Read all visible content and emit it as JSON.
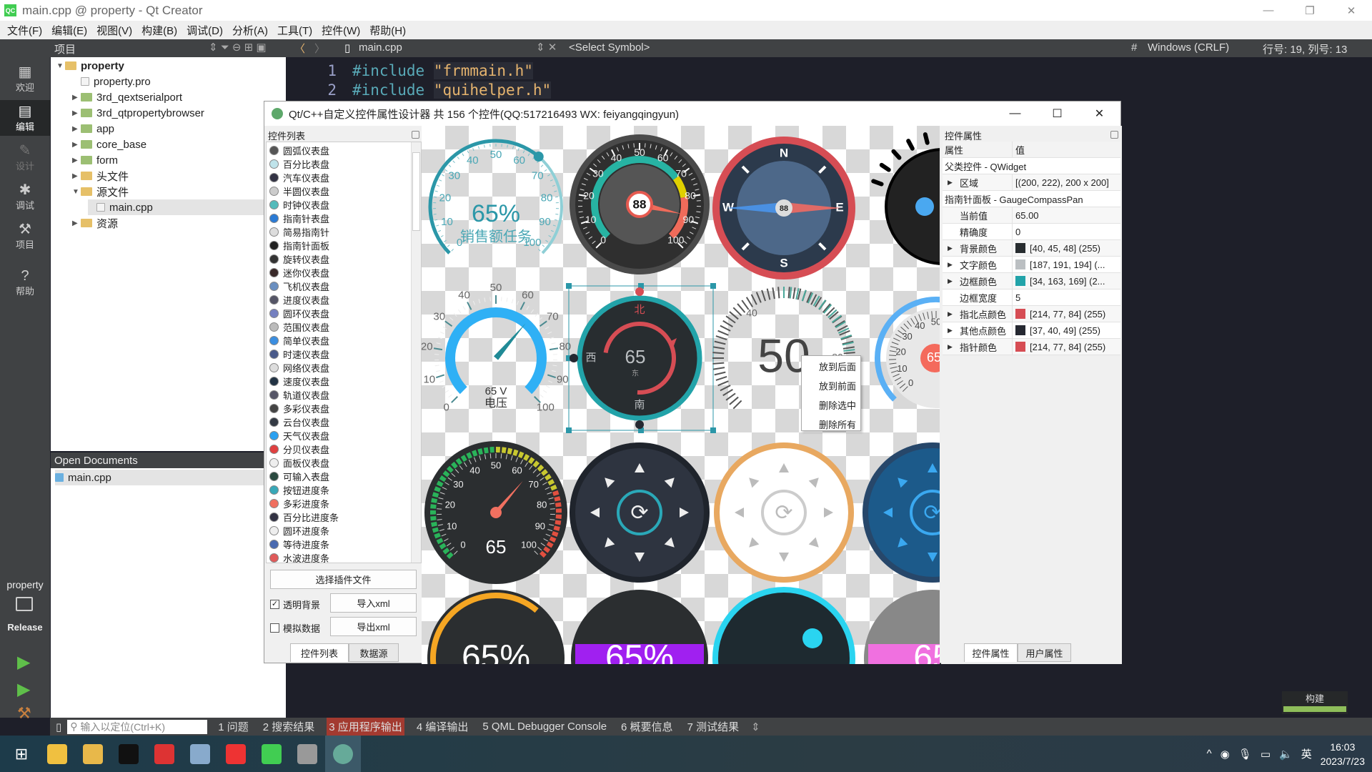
{
  "window": {
    "title": "main.cpp @ property - Qt Creator",
    "minimize": "—",
    "restore": "❐",
    "close": "✕",
    "logo": "QC"
  },
  "menu": [
    "文件(F)",
    "编辑(E)",
    "视图(V)",
    "构建(B)",
    "调试(D)",
    "分析(A)",
    "工具(T)",
    "控件(W)",
    "帮助(H)"
  ],
  "toolbar": {
    "projects_label": "项目",
    "file": "main.cpp",
    "symbol": "<Select Symbol>",
    "hash": "#",
    "line_ending": "Windows (CRLF)",
    "position": "行号: 19, 列号: 13"
  },
  "modes": [
    {
      "label": "欢迎",
      "icon": "grid-icon"
    },
    {
      "label": "编辑",
      "icon": "edit-icon"
    },
    {
      "label": "设计",
      "icon": "pencil-icon"
    },
    {
      "label": "调试",
      "icon": "bug-icon"
    },
    {
      "label": "项目",
      "icon": "wrench-icon"
    },
    {
      "label": "帮助",
      "icon": "help-icon"
    }
  ],
  "kit": {
    "project": "property",
    "config": "Release"
  },
  "tree": [
    {
      "label": "property",
      "level": 0,
      "open": true,
      "bold": true
    },
    {
      "label": "property.pro",
      "level": 1
    },
    {
      "label": "3rd_qextserialport",
      "level": 1,
      "closed": true
    },
    {
      "label": "3rd_qtpropertybrowser",
      "level": 1,
      "closed": true
    },
    {
      "label": "app",
      "level": 1,
      "closed": true
    },
    {
      "label": "core_base",
      "level": 1,
      "closed": true
    },
    {
      "label": "form",
      "level": 1,
      "closed": true
    },
    {
      "label": "头文件",
      "level": 1,
      "closed": true
    },
    {
      "label": "源文件",
      "level": 1,
      "open": true
    },
    {
      "label": "main.cpp",
      "level": 2,
      "selected": true
    },
    {
      "label": "资源",
      "level": 1,
      "closed": true
    }
  ],
  "open_documents": {
    "title": "Open Documents",
    "items": [
      "main.cpp"
    ]
  },
  "code": [
    {
      "n": "1",
      "kw": "#include",
      "s": "\"frmmain.h\""
    },
    {
      "n": "2",
      "kw": "#include",
      "s": "\"quihelper.h\""
    }
  ],
  "output_tabs": [
    "1 问题",
    "2 搜索结果",
    "3 应用程序输出",
    "4 编译输出",
    "5 QML Debugger Console",
    "6 概要信息",
    "7 测试结果"
  ],
  "locate_placeholder": "输入以定位(Ctrl+K)",
  "build": {
    "label": "构建",
    "progress": 100
  },
  "clock": {
    "time": "16:03",
    "date": "2023/7/23"
  },
  "tray": {
    "ime": "英"
  },
  "dialog": {
    "title": "Qt/C++自定义控件属性设计器 共 156 个控件(QQ:517216493 WX: feiyangqingyun)",
    "list_title": "控件列表",
    "widgets": [
      {
        "n": "圆弧仪表盘",
        "c": "#555"
      },
      {
        "n": "百分比表盘",
        "c": "#bfe3ea"
      },
      {
        "n": "汽车仪表盘",
        "c": "#334"
      },
      {
        "n": "半圆仪表盘",
        "c": "#ccc"
      },
      {
        "n": "时钟仪表盘",
        "c": "#5bb"
      },
      {
        "n": "指南针表盘",
        "c": "#2a7ad4"
      },
      {
        "n": "简易指南针",
        "c": "#ddd"
      },
      {
        "n": "指南针面板",
        "c": "#222"
      },
      {
        "n": "旋转仪表盘",
        "c": "#333"
      },
      {
        "n": "迷你仪表盘",
        "c": "#3a2a2a"
      },
      {
        "n": "飞机仪表盘",
        "c": "#6a8fc0"
      },
      {
        "n": "进度仪表盘",
        "c": "#556"
      },
      {
        "n": "圆环仪表盘",
        "c": "#7580c0"
      },
      {
        "n": "范围仪表盘",
        "c": "#bbb"
      },
      {
        "n": "简单仪表盘",
        "c": "#3b8ee0"
      },
      {
        "n": "时速仪表盘",
        "c": "#4a5a8a"
      },
      {
        "n": "网络仪表盘",
        "c": "#ddd"
      },
      {
        "n": "速度仪表盘",
        "c": "#234"
      },
      {
        "n": "轨道仪表盘",
        "c": "#556"
      },
      {
        "n": "多彩仪表盘",
        "c": "#444"
      },
      {
        "n": "云台仪表盘",
        "c": "#333a44"
      },
      {
        "n": "天气仪表盘",
        "c": "#2aa0f0"
      },
      {
        "n": "分贝仪表盘",
        "c": "#e04040"
      },
      {
        "n": "面板仪表盘",
        "c": "#eee"
      },
      {
        "n": "可输入表盘",
        "c": "#2a4a40"
      },
      {
        "n": "按钮进度条",
        "c": "#38a8b8"
      },
      {
        "n": "多彩进度条",
        "c": "#f07060"
      },
      {
        "n": "百分比进度条",
        "c": "#334"
      },
      {
        "n": "圆环进度条",
        "c": "#eee"
      },
      {
        "n": "等待进度条",
        "c": "#4a6ab0"
      },
      {
        "n": "水波进度条",
        "c": "#e05a5a"
      }
    ],
    "select_plugin": "选择插件文件",
    "transparent_bg": {
      "label": "透明背景",
      "checked": true
    },
    "simulate": {
      "label": "模拟数据",
      "checked": false
    },
    "import_xml": "导入xml",
    "export_xml": "导出xml",
    "left_tabs": [
      "控件列表",
      "数据源"
    ],
    "context_menu": [
      "放到后面",
      "放到前面",
      "删除选中",
      "删除所有"
    ],
    "props_title": "控件属性",
    "props_header": [
      "属性",
      "值"
    ],
    "props": [
      {
        "group": "父类控件 - QWidget"
      },
      {
        "k": "区域",
        "v": "[(200, 222), 200 x 200]",
        "exp": true
      },
      {
        "group": "指南针面板 - GaugeCompassPan"
      },
      {
        "k": "当前值",
        "v": "65.00"
      },
      {
        "k": "精确度",
        "v": "0"
      },
      {
        "k": "背景颜色",
        "v": "[40, 45, 48] (255)",
        "color": "#282d30",
        "exp": true
      },
      {
        "k": "文字颜色",
        "v": "[187, 191, 194] (...",
        "color": "#bbbfc2",
        "exp": true
      },
      {
        "k": "边框颜色",
        "v": "[34, 163, 169] (2...",
        "color": "#22a3a9",
        "exp": true
      },
      {
        "k": "边框宽度",
        "v": "5"
      },
      {
        "k": "指北点颜色",
        "v": "[214, 77, 84] (255)",
        "color": "#d64d54",
        "exp": true
      },
      {
        "k": "其他点颜色",
        "v": "[37, 40, 49] (255)",
        "color": "#252831",
        "exp": true
      },
      {
        "k": "指针颜色",
        "v": "[214, 77, 84] (255)",
        "color": "#d64d54",
        "exp": true
      }
    ],
    "right_tabs": [
      "控件属性",
      "用户属性"
    ],
    "gauges": {
      "scale": [
        "0",
        "10",
        "20",
        "30",
        "40",
        "50",
        "60",
        "70",
        "80",
        "90",
        "100"
      ],
      "arc": {
        "value": 65,
        "text": "65%",
        "caption": "销售额任务"
      },
      "car": {
        "value": 88,
        "text": "88"
      },
      "compass": {
        "value": 88,
        "text": "88",
        "n": "N",
        "e": "E",
        "s": "S",
        "w": "W"
      },
      "voltage": {
        "value": 65,
        "text": "65 V",
        "caption": "电压"
      },
      "compass_panel": {
        "value": 65,
        "text": "65",
        "n": "北",
        "w": "西",
        "e": "东",
        "s": "南"
      },
      "range": {
        "text": "50",
        "l1": "40",
        "l2": "80"
      },
      "colorful": {
        "value": 65,
        "text": "65"
      },
      "partial_text": "65",
      "bottom": [
        "65%",
        "65%",
        "65"
      ]
    }
  }
}
